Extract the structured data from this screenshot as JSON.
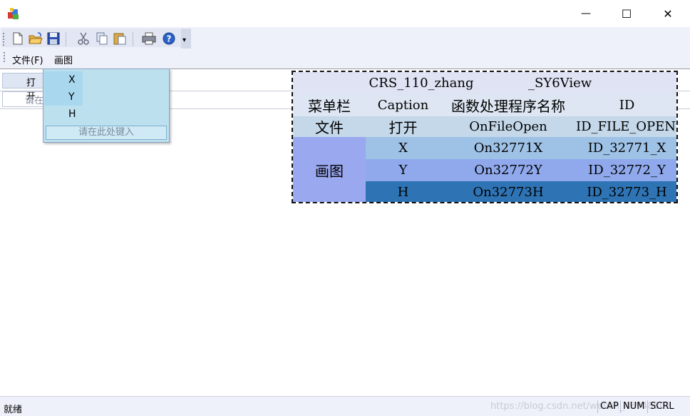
{
  "window": {
    "minimize_glyph": "—",
    "maximize_glyph": "☐",
    "close_glyph": "✕"
  },
  "toolbar": {
    "buttons": [
      "new-icon",
      "open-icon",
      "save-icon",
      "cut-icon",
      "copy-icon",
      "paste-icon",
      "print-icon",
      "help-icon"
    ],
    "overflow_glyph": "▾"
  },
  "menu": {
    "file": "文件(F)",
    "draw": "画图"
  },
  "editor": {
    "open_item": "打开",
    "type_here": "请在"
  },
  "dropdown": {
    "items": [
      "X",
      "Y",
      "H"
    ],
    "type_here": "请在此处键入"
  },
  "annotation": {
    "project": "CRS_110_zhang",
    "view": "_SY6View",
    "headers": [
      "菜单栏",
      "Caption",
      "函数处理程序名称",
      "ID"
    ],
    "file_menu": "文件",
    "draw_menu": "画图",
    "rows": [
      {
        "caption": "打开",
        "handler": "OnFileOpen",
        "id": "ID_FILE_OPEN"
      },
      {
        "caption": "X",
        "handler": "On32771X",
        "id": "ID_32771_X"
      },
      {
        "caption": "Y",
        "handler": "On32772Y",
        "id": "ID_32772_Y"
      },
      {
        "caption": "H",
        "handler": "On32773H",
        "id": "ID_32773_H"
      }
    ]
  },
  "status": {
    "ready": "就绪",
    "watermark": "https://blog.csdn.net/weixin_43948802",
    "indicators": [
      "CAP",
      "NUM",
      "SCRL"
    ]
  },
  "colors": {
    "row_file": "#c4d8ea",
    "row_x": "#9ec1e6",
    "row_y": "#8fa9ec",
    "row_h": "#2e74b5",
    "draw_cell": "#9aa8f0",
    "header_bg": "#dde6f2",
    "title_bg": "#dfe3f3"
  }
}
